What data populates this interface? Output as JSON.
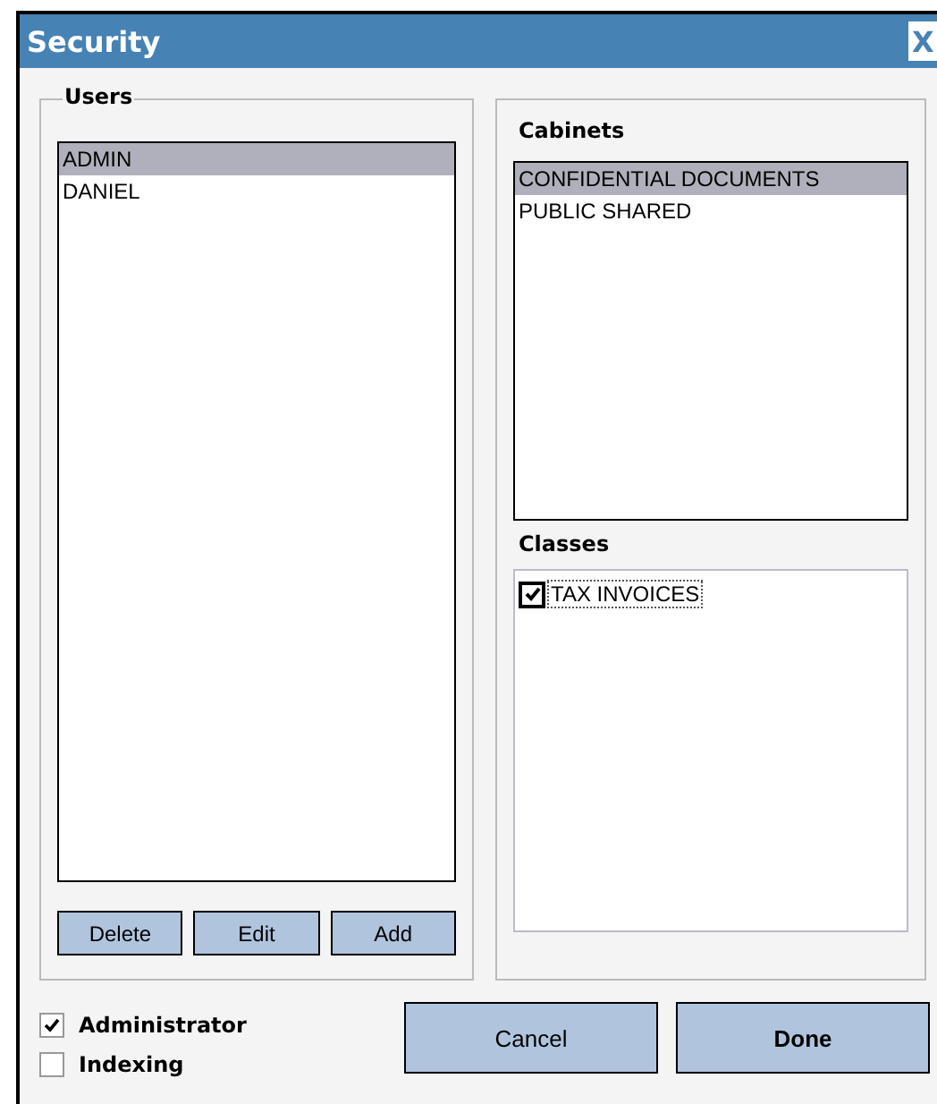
{
  "window": {
    "title": "Security",
    "close": "X"
  },
  "users": {
    "title": "Users",
    "items": [
      {
        "label": "ADMIN",
        "selected": true
      },
      {
        "label": "DANIEL",
        "selected": false
      }
    ],
    "buttons": [
      "Delete",
      "Edit",
      "Add"
    ]
  },
  "cabinets": {
    "title": "Cabinets",
    "items": [
      {
        "label": "CONFIDENTIAL DOCUMENTS",
        "selected": true
      },
      {
        "label": "PUBLIC SHARED",
        "selected": false
      }
    ]
  },
  "classes": {
    "title": "Classes",
    "items": [
      {
        "label": "TAX INVOICES",
        "checked": true
      }
    ]
  },
  "options": [
    {
      "label": "Administrator",
      "checked": true
    },
    {
      "label": "Indexing",
      "checked": false
    }
  ],
  "buttons": [
    {
      "label": "Cancel",
      "kind": "normal"
    },
    {
      "label": "Done",
      "kind": "default"
    }
  ]
}
